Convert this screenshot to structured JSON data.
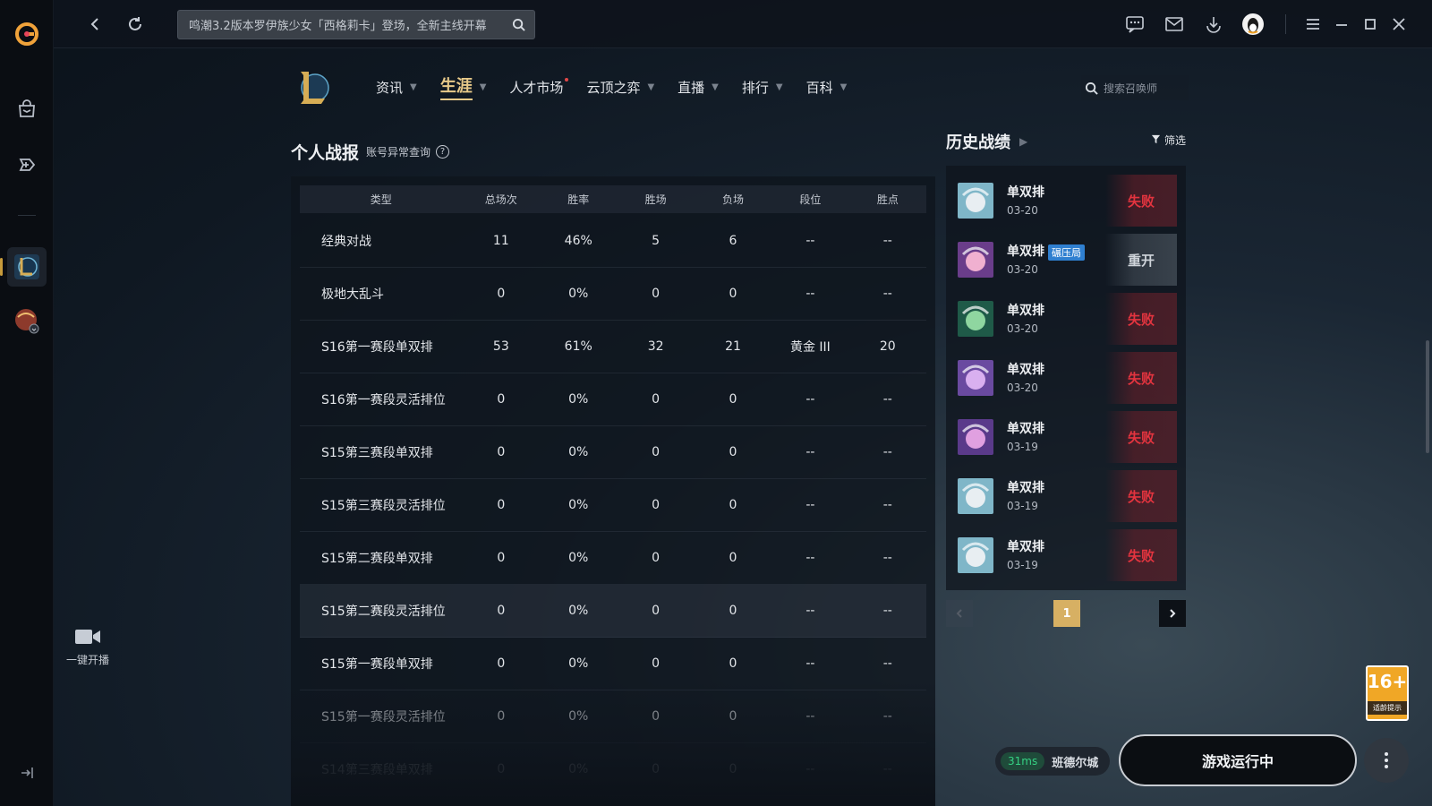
{
  "topbar": {
    "search_text": "鸣潮3.2版本罗伊族少女「西格莉卡」登场，全新主线开幕"
  },
  "rail": {
    "onekey_label": "一键开播"
  },
  "nav": {
    "items": [
      {
        "label": "资讯"
      },
      {
        "label": "生涯"
      },
      {
        "label": "人才市场"
      },
      {
        "label": "云顶之弈"
      },
      {
        "label": "直播"
      },
      {
        "label": "排行"
      },
      {
        "label": "百科"
      }
    ],
    "summoner_search_placeholder": "搜索召唤师"
  },
  "stats": {
    "title": "个人战报",
    "account_check": "账号异常查询",
    "headers": [
      "类型",
      "总场次",
      "胜率",
      "胜场",
      "负场",
      "段位",
      "胜点"
    ],
    "rows": [
      [
        "经典对战",
        "11",
        "46%",
        "5",
        "6",
        "--",
        "--"
      ],
      [
        "极地大乱斗",
        "0",
        "0%",
        "0",
        "0",
        "--",
        "--"
      ],
      [
        "S16第一赛段单双排",
        "53",
        "61%",
        "32",
        "21",
        "黄金 III",
        "20"
      ],
      [
        "S16第一赛段灵活排位",
        "0",
        "0%",
        "0",
        "0",
        "--",
        "--"
      ],
      [
        "S15第三赛段单双排",
        "0",
        "0%",
        "0",
        "0",
        "--",
        "--"
      ],
      [
        "S15第三赛段灵活排位",
        "0",
        "0%",
        "0",
        "0",
        "--",
        "--"
      ],
      [
        "S15第二赛段单双排",
        "0",
        "0%",
        "0",
        "0",
        "--",
        "--"
      ],
      [
        "S15第二赛段灵活排位",
        "0",
        "0%",
        "0",
        "0",
        "--",
        "--"
      ],
      [
        "S15第一赛段单双排",
        "0",
        "0%",
        "0",
        "0",
        "--",
        "--"
      ],
      [
        "S15第一赛段灵活排位",
        "0",
        "0%",
        "0",
        "0",
        "--",
        "--"
      ],
      [
        "S14第三赛段单双排",
        "0",
        "0%",
        "0",
        "0",
        "--",
        "--"
      ]
    ]
  },
  "history": {
    "title": "历史战绩",
    "filter": "筛选",
    "matches": [
      {
        "mode": "单双排",
        "date": "03-20",
        "result": "失败",
        "kind": "lose",
        "tag": ""
      },
      {
        "mode": "单双排",
        "date": "03-20",
        "result": "重开",
        "kind": "remake",
        "tag": "碾压局"
      },
      {
        "mode": "单双排",
        "date": "03-20",
        "result": "失败",
        "kind": "lose",
        "tag": ""
      },
      {
        "mode": "单双排",
        "date": "03-20",
        "result": "失败",
        "kind": "lose",
        "tag": ""
      },
      {
        "mode": "单双排",
        "date": "03-19",
        "result": "失败",
        "kind": "lose",
        "tag": ""
      },
      {
        "mode": "单双排",
        "date": "03-19",
        "result": "失败",
        "kind": "lose",
        "tag": ""
      },
      {
        "mode": "单双排",
        "date": "03-19",
        "result": "失败",
        "kind": "lose",
        "tag": ""
      }
    ],
    "page": "1"
  },
  "bottom": {
    "age_rating": "16+",
    "age_note": "适龄提示",
    "ping": "31ms",
    "server": "班德尔城",
    "play_status": "游戏运行中"
  },
  "colors": {
    "accent_gold": "#e7c989",
    "lose_red": "#e3343f",
    "ping_green": "#35d283",
    "tag_blue": "#2f7fd0"
  }
}
